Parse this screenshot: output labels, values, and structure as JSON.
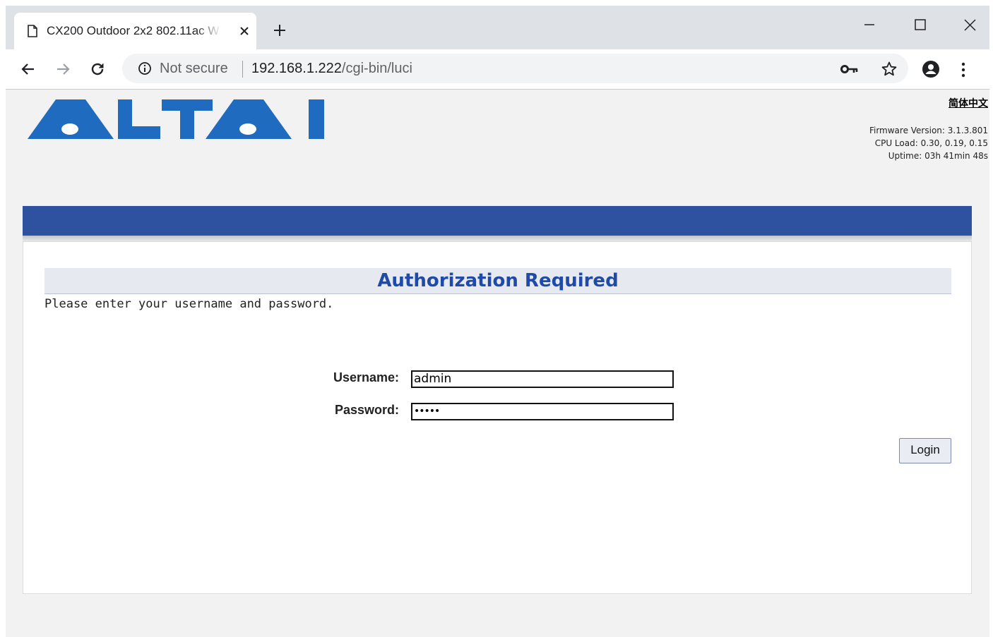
{
  "browser": {
    "tab_title": "CX200 Outdoor 2x2 802.11ac W",
    "security_label": "Not secure",
    "url_host": "192.168.1.222",
    "url_path": "/cgi-bin/luci"
  },
  "header": {
    "logo_text": "ALTAI",
    "language_link": "简体中文",
    "firmware": "Firmware Version: 3.1.3.801",
    "cpu_load": "CPU Load: 0.30, 0.19, 0.15",
    "uptime": "Uptime: 03h 41min 48s"
  },
  "login": {
    "heading": "Authorization Required",
    "description": "Please enter your username and password.",
    "username_label": "Username:",
    "username_value": "admin",
    "password_label": "Password:",
    "password_value": "•••••",
    "login_button": "Login"
  },
  "colors": {
    "brand_blue": "#1f6bc0",
    "bar_blue": "#2f52a0",
    "heading_blue": "#1f4aa8"
  }
}
